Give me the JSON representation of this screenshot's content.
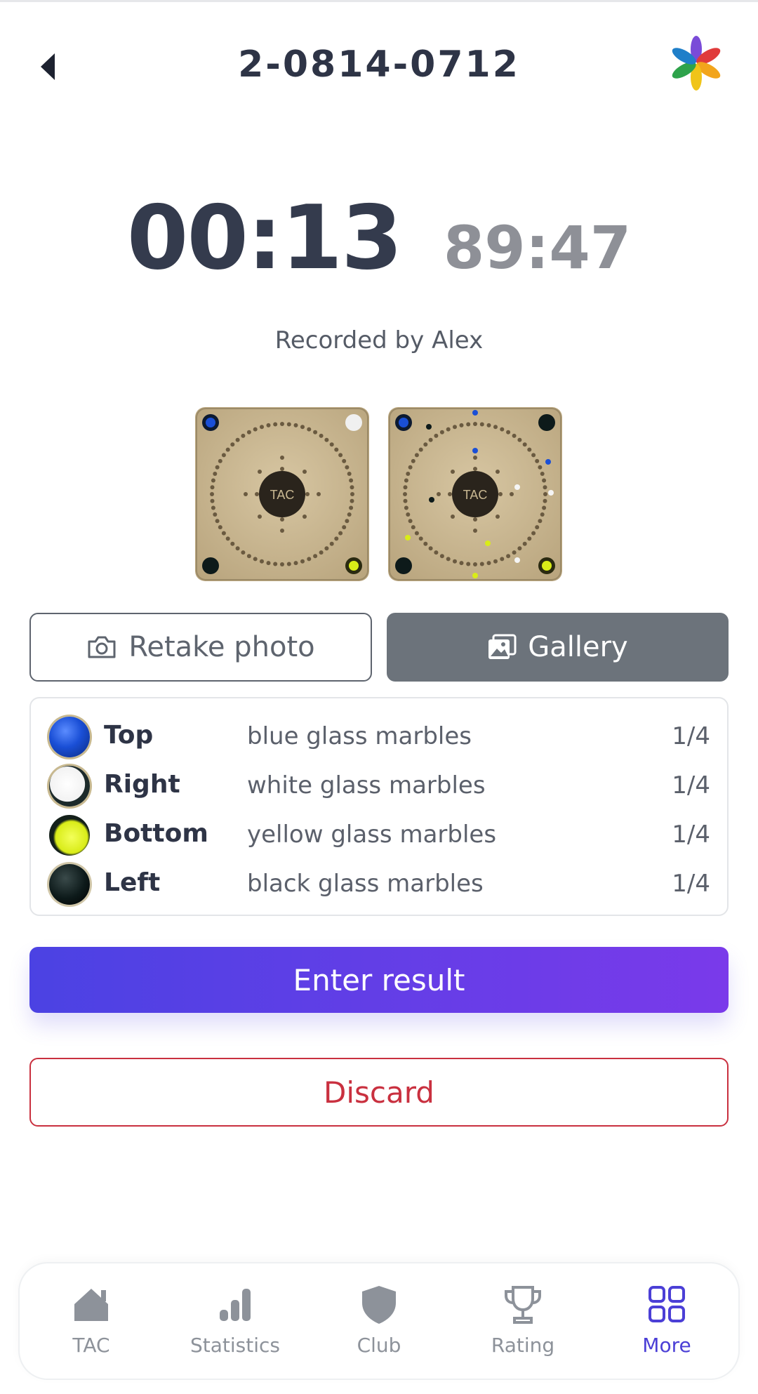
{
  "header": {
    "title": "2-0814-0712"
  },
  "timers": {
    "elapsed": "00:13",
    "remaining": "89:47"
  },
  "recorded_by": "Recorded by Alex",
  "photos": {
    "board_text": "TAC"
  },
  "actions": {
    "retake_label": "Retake photo",
    "gallery_label": "Gallery"
  },
  "players": [
    {
      "position": "Top",
      "marbles": "blue glass marbles",
      "fraction": "1/4",
      "color": "#1a4fd6"
    },
    {
      "position": "Right",
      "marbles": "white glass marbles",
      "fraction": "1/4",
      "color": "#f6f6f6"
    },
    {
      "position": "Bottom",
      "marbles": "yellow glass marbles",
      "fraction": "1/4",
      "color": "#d9ec18"
    },
    {
      "position": "Left",
      "marbles": "black glass marbles",
      "fraction": "1/4",
      "color": "#0d1a1a"
    }
  ],
  "buttons": {
    "enter_result": "Enter result",
    "discard": "Discard"
  },
  "nav": {
    "items": [
      {
        "label": "TAC",
        "icon": "home-icon"
      },
      {
        "label": "Statistics",
        "icon": "bar-chart-icon"
      },
      {
        "label": "Club",
        "icon": "shield-icon"
      },
      {
        "label": "Rating",
        "icon": "trophy-icon"
      },
      {
        "label": "More",
        "icon": "grid-icon",
        "active": true
      }
    ]
  },
  "colors": {
    "accent": "#4b3fd6",
    "danger": "#c9303f",
    "gallery_bg": "#6c737b"
  }
}
